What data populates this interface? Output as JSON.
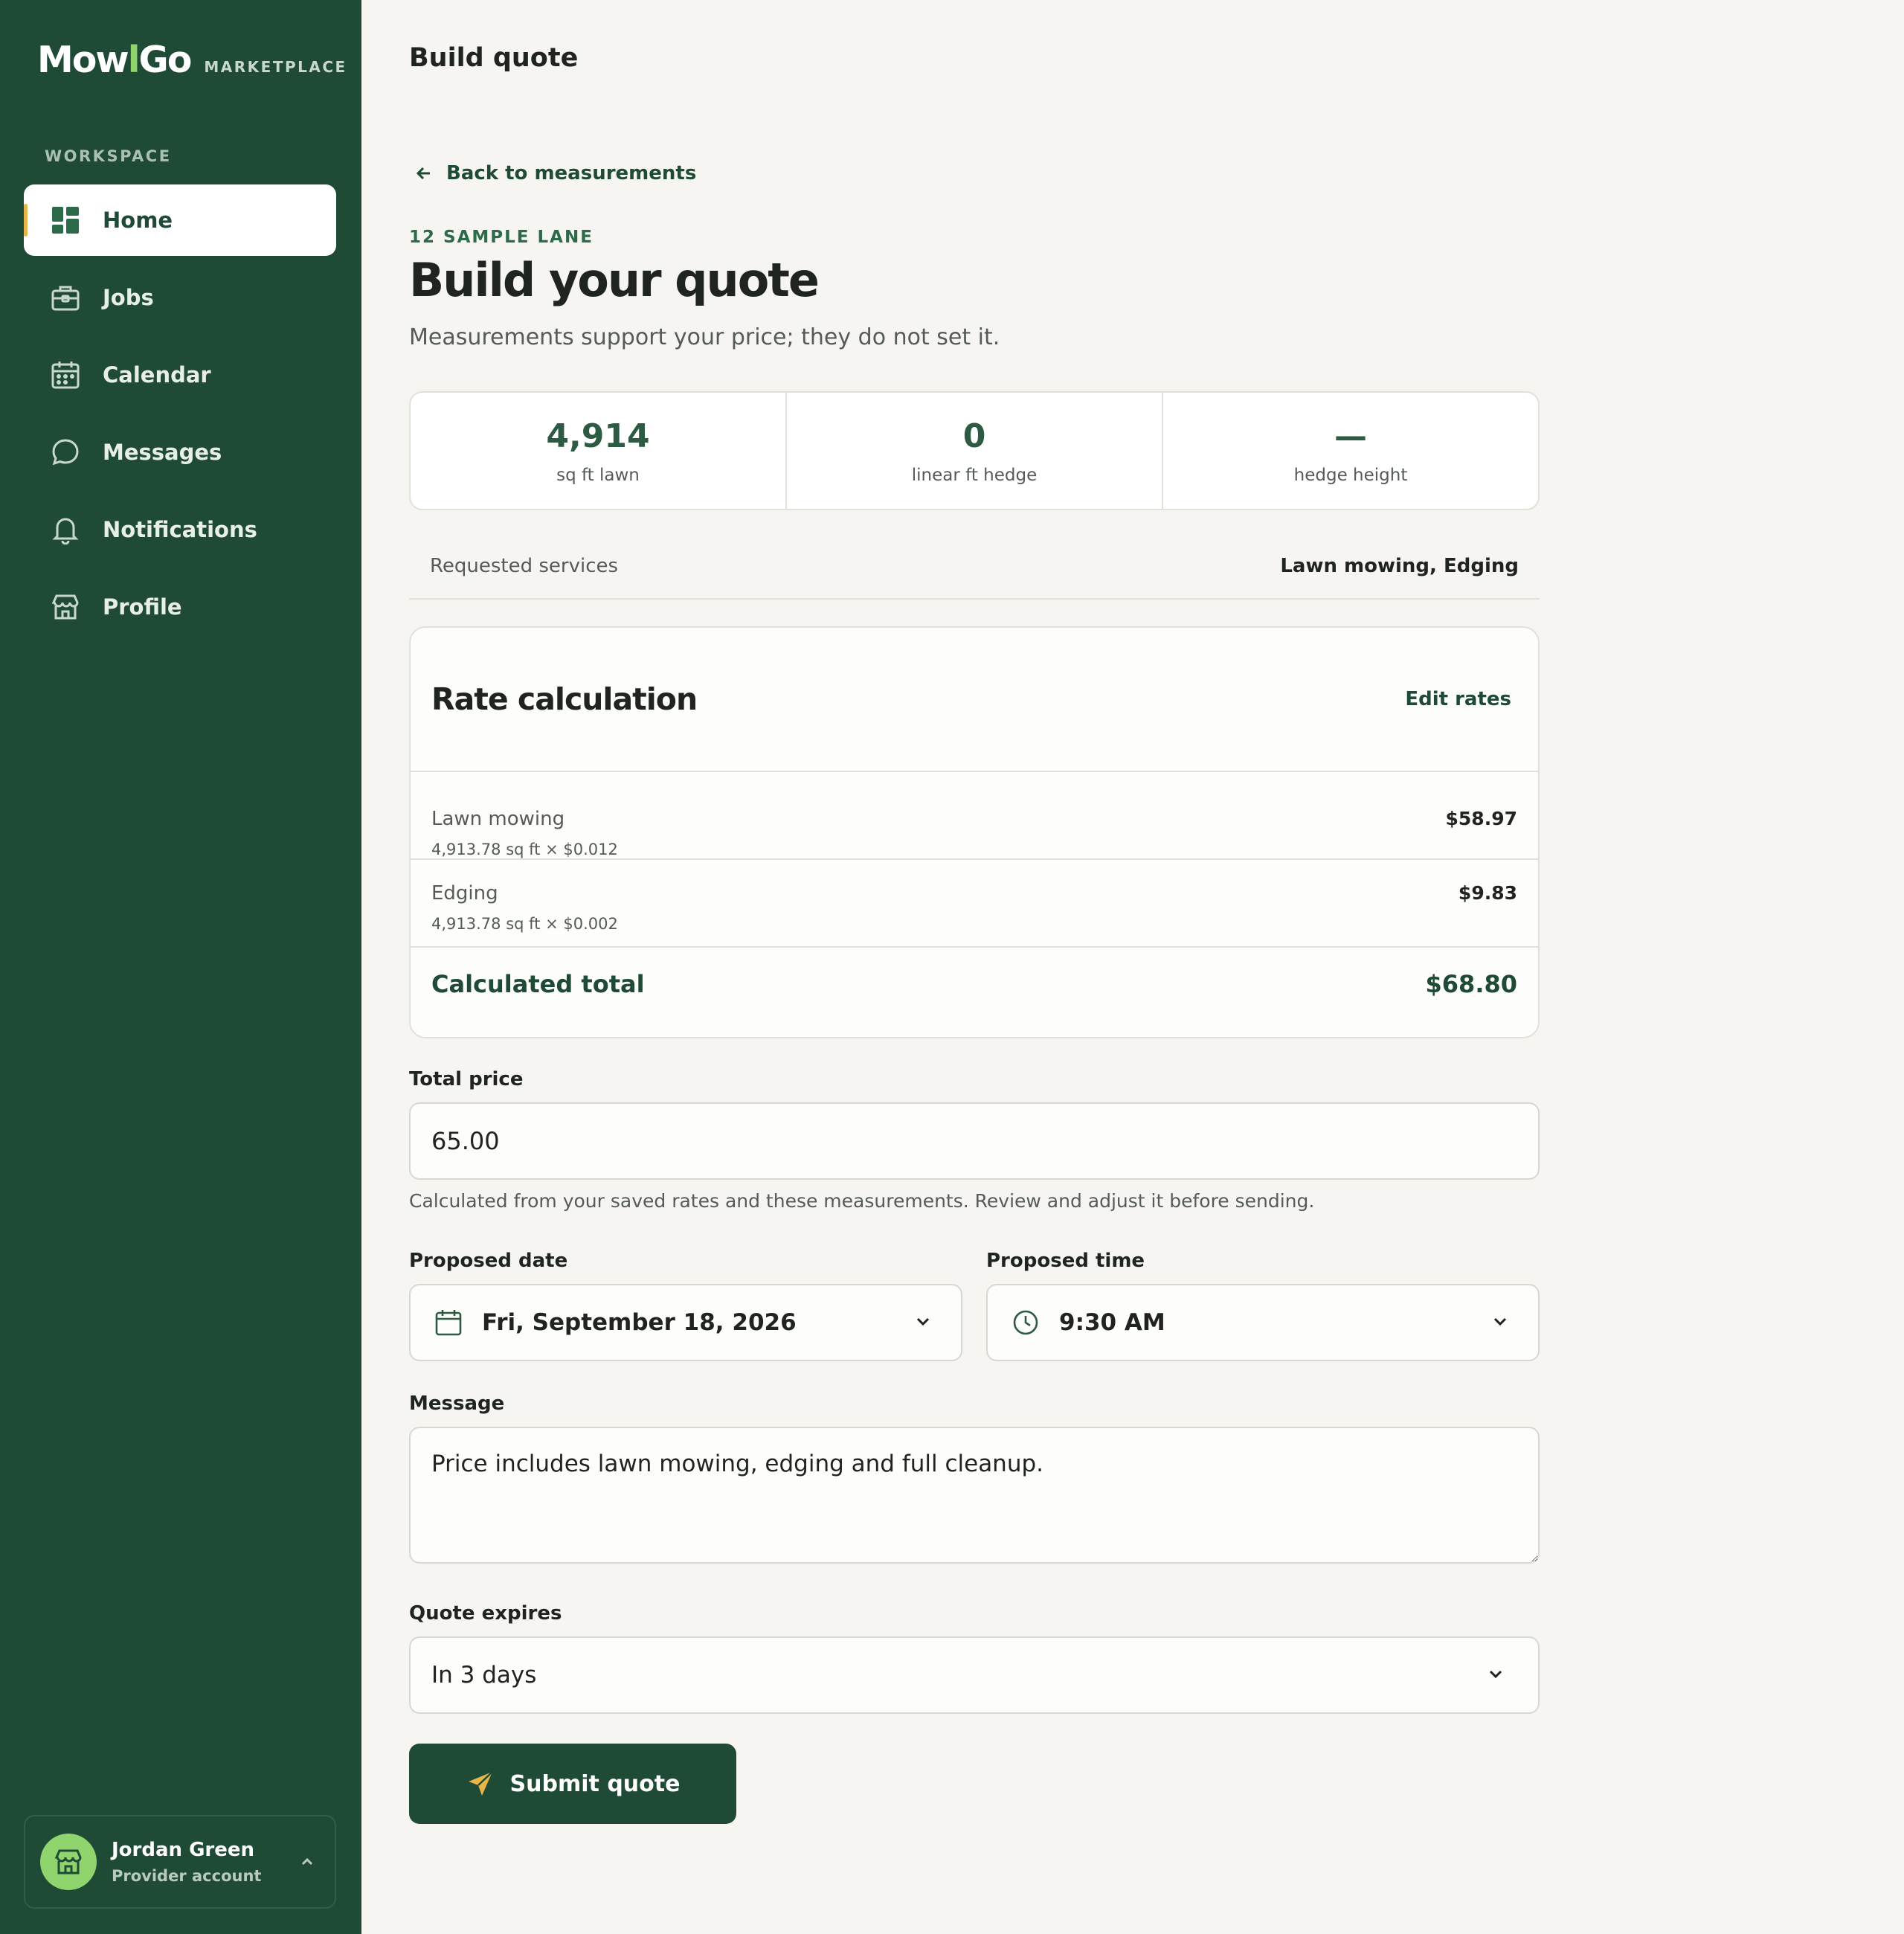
{
  "brand": {
    "name_part1": "Mow",
    "name_part2": "Go",
    "tagline": "MARKETPLACE",
    "accent_color": "#8fd46d",
    "primary_color": "#1f4a35"
  },
  "sidebar": {
    "section_label": "WORKSPACE",
    "items": [
      {
        "label": "Home",
        "icon": "dashboard-icon",
        "active": true
      },
      {
        "label": "Jobs",
        "icon": "briefcase-icon"
      },
      {
        "label": "Calendar",
        "icon": "calendar-icon"
      },
      {
        "label": "Messages",
        "icon": "chat-bubble-icon"
      },
      {
        "label": "Notifications",
        "icon": "bell-icon"
      },
      {
        "label": "Profile",
        "icon": "storefront-icon"
      }
    ],
    "user": {
      "name": "Jordan Green",
      "role": "Provider account",
      "icon": "storefront-icon"
    }
  },
  "header": {
    "title": "Build quote"
  },
  "main": {
    "back_link": "Back to measurements",
    "eyebrow": "12 SAMPLE LANE",
    "title": "Build your quote",
    "subtitle": "Measurements support your price; they do not set it.",
    "stats": [
      {
        "value": "4,914",
        "label": "sq ft lawn"
      },
      {
        "value": "0",
        "label": "linear ft hedge"
      },
      {
        "value": "—",
        "label": "hedge height"
      }
    ],
    "requested_services": {
      "label": "Requested services",
      "value": "Lawn mowing, Edging"
    },
    "rate_calculation": {
      "title": "Rate calculation",
      "edit_label": "Edit rates",
      "lines": [
        {
          "name": "Lawn mowing",
          "detail": "4,913.78 sq ft × $0.012",
          "amount": "$58.97"
        },
        {
          "name": "Edging",
          "detail": "4,913.78 sq ft × $0.002",
          "amount": "$9.83"
        }
      ],
      "total_label": "Calculated total",
      "total_value": "$68.80"
    },
    "form": {
      "total_price": {
        "label": "Total price",
        "value": "65.00",
        "helper": "Calculated from your saved rates and these measurements. Review and adjust it before sending."
      },
      "proposed_date": {
        "label": "Proposed date",
        "value": "Fri, September 18, 2026"
      },
      "proposed_time": {
        "label": "Proposed time",
        "value": "9:30 AM"
      },
      "message": {
        "label": "Message",
        "value": "Price includes lawn mowing, edging and full cleanup."
      },
      "quote_expires": {
        "label": "Quote expires",
        "value": "In 3 days"
      },
      "submit_label": "Submit quote"
    }
  }
}
